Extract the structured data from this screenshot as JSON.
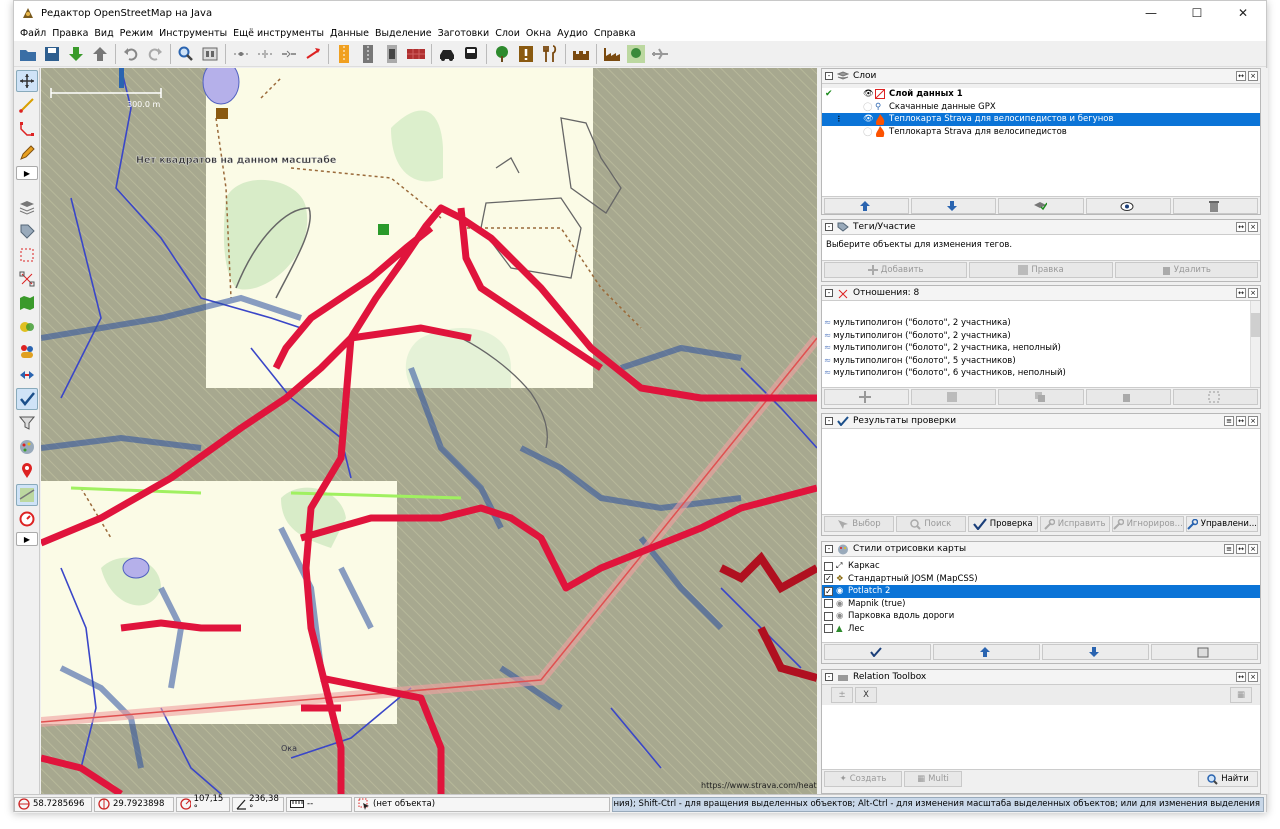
{
  "window": {
    "title": "Редактор OpenStreetMap на Java"
  },
  "menu": [
    "Файл",
    "Правка",
    "Вид",
    "Режим",
    "Инструменты",
    "Ещё инструменты",
    "Данные",
    "Выделение",
    "Заготовки",
    "Слои",
    "Окна",
    "Аудио",
    "Справка"
  ],
  "map": {
    "scale_label": "300.0 m",
    "no_tiles_text": "Нет квадратов на данном масштабе",
    "attribution": "https://www.strava.com/heatmap",
    "road_label": "Ока"
  },
  "layers_panel": {
    "title": "Слои",
    "items": [
      {
        "name": "Слой данных 1",
        "bold": true
      },
      {
        "name": "Скачанные данные GPX"
      },
      {
        "name": "Теплокарта Strava для велосипедистов и бегунов",
        "selected": true
      },
      {
        "name": "Теплокарта Strava для велосипедистов"
      }
    ]
  },
  "tags_panel": {
    "title": "Теги/Участие",
    "message": "Выберите объекты для изменения тегов.",
    "buttons": {
      "add": "Добавить",
      "edit": "Правка",
      "delete": "Удалить"
    }
  },
  "relations_panel": {
    "title": "Отношения: 8",
    "items": [
      "мультиполигон (\"болото\", 2 участника)",
      "мультиполигон (\"болото\", 2 участника)",
      "мультиполигон (\"болото\", 2 участника, неполный)",
      "мультиполигон (\"болото\", 5 участников)",
      "мультиполигон (\"болото\", 6 участников, неполный)"
    ]
  },
  "validation_panel": {
    "title": "Результаты проверки",
    "buttons": {
      "select": "Выбор",
      "search": "Поиск",
      "validate": "Проверка",
      "fix": "Исправить",
      "ignore": "Игнориров...",
      "manage": "Управлени..."
    }
  },
  "styles_panel": {
    "title": "Стили отрисовки карты",
    "items": [
      {
        "name": "Каркас",
        "checked": false
      },
      {
        "name": "Стандартный JOSM (MapCSS)",
        "checked": true
      },
      {
        "name": "Potlatch 2",
        "checked": true,
        "selected": true
      },
      {
        "name": "Mapnik (true)",
        "checked": false
      },
      {
        "name": "Парковка вдоль дороги",
        "checked": false
      },
      {
        "name": "Лес",
        "checked": false
      }
    ]
  },
  "relation_toolbox": {
    "title": "Relation Toolbox",
    "buttons": {
      "create": "Создать",
      "multi": "Multi",
      "find": "Найти"
    }
  },
  "status": {
    "lat": "58.7285696",
    "lon": "29.7923898",
    "heading": "107,15 °",
    "angle": "236,38 °",
    "distance": "--",
    "object": "(нет объекта)",
    "help": "для переключения); Shift-Ctrl - для вращения выделенных объектов; Alt-Ctrl - для изменения масштаба выделенных объектов; или для изменения выделения"
  },
  "colors": {
    "selection": "#0b74d7",
    "heat": "#e0143c",
    "bg_map": "#a7a88f"
  }
}
